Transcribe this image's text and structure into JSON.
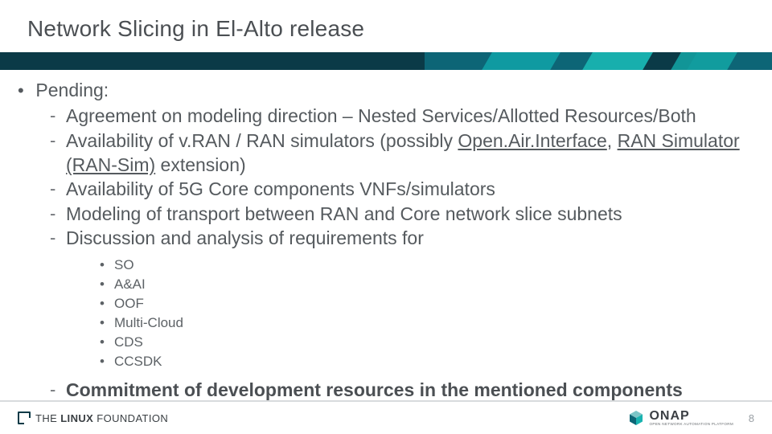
{
  "slide": {
    "title": "Network Slicing in El-Alto release",
    "pending_label": "Pending:",
    "items": [
      {
        "text": "Agreement on modeling direction – Nested Services/Allotted Resources/Both"
      },
      {
        "prefix": "Availability of v.RAN / RAN simulators (possibly ",
        "link1": "Open.Air.Interface",
        "mid1": ", ",
        "link2": "RAN Simulator (RAN-Sim)",
        "suffix": " extension)"
      },
      {
        "text": "Availability of 5G Core components VNFs/simulators"
      },
      {
        "text": "Modeling of transport between RAN and Core network slice subnets"
      },
      {
        "text": "Discussion and analysis of requirements for"
      }
    ],
    "sub_items": [
      "SO",
      "A&AI",
      "OOF",
      "Multi-Cloud",
      "CDS",
      "CCSDK"
    ],
    "closing_bold": "Commitment of development resources in the mentioned components"
  },
  "footer": {
    "linux_foundation_prefix": "THE",
    "linux_foundation_bold": "LINUX",
    "linux_foundation_suffix": "FOUNDATION",
    "onap_name": "ONAP",
    "onap_tag": "OPEN NETWORK AUTOMATION PLATFORM",
    "page_number": "8"
  },
  "colors": {
    "band_dark": "#0b3a47",
    "band_mid": "#0d6576",
    "accent": "#13a6a6"
  }
}
